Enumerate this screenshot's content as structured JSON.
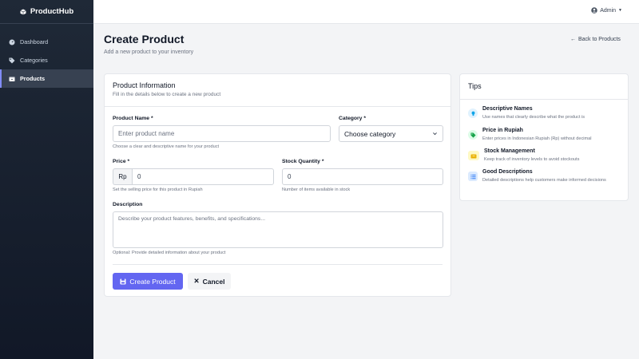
{
  "app": {
    "name": "ProductHub"
  },
  "sidebar": {
    "items": [
      {
        "label": "Dashboard",
        "icon": "dashboard-icon",
        "active": false
      },
      {
        "label": "Categories",
        "icon": "tag-icon",
        "active": false
      },
      {
        "label": "Products",
        "icon": "box-icon",
        "active": true
      }
    ]
  },
  "topbar": {
    "user_label": "Admin"
  },
  "header": {
    "title": "Create Product",
    "subtitle": "Add a new product to your inventory",
    "back_label": "Back to Products"
  },
  "form": {
    "card_title": "Product Information",
    "card_subtitle": "Fill in the details below to create a new product",
    "name": {
      "label": "Product Name *",
      "placeholder": "Enter product name",
      "help": "Choose a clear and descriptive name for your product"
    },
    "category": {
      "label": "Category *",
      "selected": "Choose category"
    },
    "price": {
      "label": "Price *",
      "prefix": "Rp",
      "value": "0",
      "help": "Set the selling price for this product in Rupiah"
    },
    "stock": {
      "label": "Stock Quantity *",
      "value": "0",
      "help": "Number of items available in stock"
    },
    "description": {
      "label": "Description",
      "placeholder": "Describe your product features, benefits, and specifications...",
      "help": "Optional: Provide detailed information about your product"
    },
    "submit_label": "Create Product",
    "cancel_label": "Cancel"
  },
  "tips": {
    "title": "Tips",
    "items": [
      {
        "title": "Descriptive Names",
        "desc": "Use names that clearly describe what the product is",
        "icon": "lightbulb-icon",
        "color": "#0ea5e9"
      },
      {
        "title": "Price in Rupiah",
        "desc": "Enter prices in Indonesian Rupiah (Rp) without decimal",
        "icon": "price-tag-icon",
        "color": "#16a34a"
      },
      {
        "title": "Stock Management",
        "desc": "Keep track of inventory levels to avoid stockouts",
        "icon": "boxes-icon",
        "color": "#eab308"
      },
      {
        "title": "Good Descriptions",
        "desc": "Detailed descriptions help customers make informed decisions",
        "icon": "list-icon",
        "color": "#3b82f6"
      }
    ]
  },
  "colors": {
    "primary": "#6366f1",
    "sidebar": "#1f2937"
  }
}
